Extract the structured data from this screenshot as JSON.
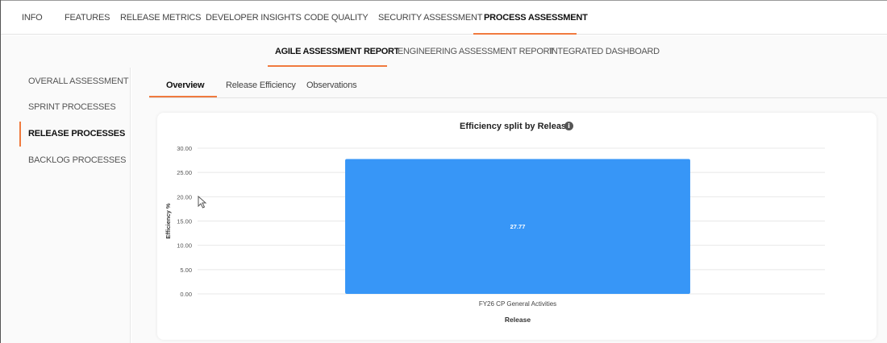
{
  "top_nav": {
    "tabs": [
      "INFO",
      "FEATURES",
      "RELEASE METRICS",
      "DEVELOPER INSIGHTS",
      "CODE QUALITY",
      "SECURITY ASSESSMENT",
      "PROCESS ASSESSMENT"
    ],
    "active": "PROCESS ASSESSMENT"
  },
  "report_tabs": {
    "tabs": [
      "AGILE ASSESSMENT REPORT",
      "ENGINEERING ASSESSMENT REPORT",
      "INTEGRATED DASHBOARD"
    ],
    "active": "AGILE ASSESSMENT REPORT"
  },
  "sidebar": {
    "items": [
      "OVERALL ASSESSMENT",
      "SPRINT PROCESSES",
      "RELEASE PROCESSES",
      "BACKLOG PROCESSES"
    ],
    "active": "RELEASE PROCESSES"
  },
  "inner_tabs": {
    "tabs": [
      "Overview",
      "Release Efficiency",
      "Observations"
    ],
    "active": "Overview"
  },
  "chart": {
    "title": "Efficiency split by Release",
    "info_icon": "info-icon"
  },
  "chart_data": {
    "type": "bar",
    "title": "Efficiency split by Release",
    "categories": [
      "FY26 CP General Activities"
    ],
    "values": [
      27.77
    ],
    "data_labels": [
      "27.77"
    ],
    "xlabel": "Release",
    "ylabel": "Efficiency %",
    "ylim": [
      0,
      30
    ],
    "yticks": [
      "0.00",
      "5.00",
      "10.00",
      "15.00",
      "20.00",
      "25.00",
      "30.00"
    ],
    "grid": true,
    "bar_color": "#3796f7"
  },
  "colors": {
    "accent": "#f07a3e",
    "bar": "#3796f7"
  }
}
